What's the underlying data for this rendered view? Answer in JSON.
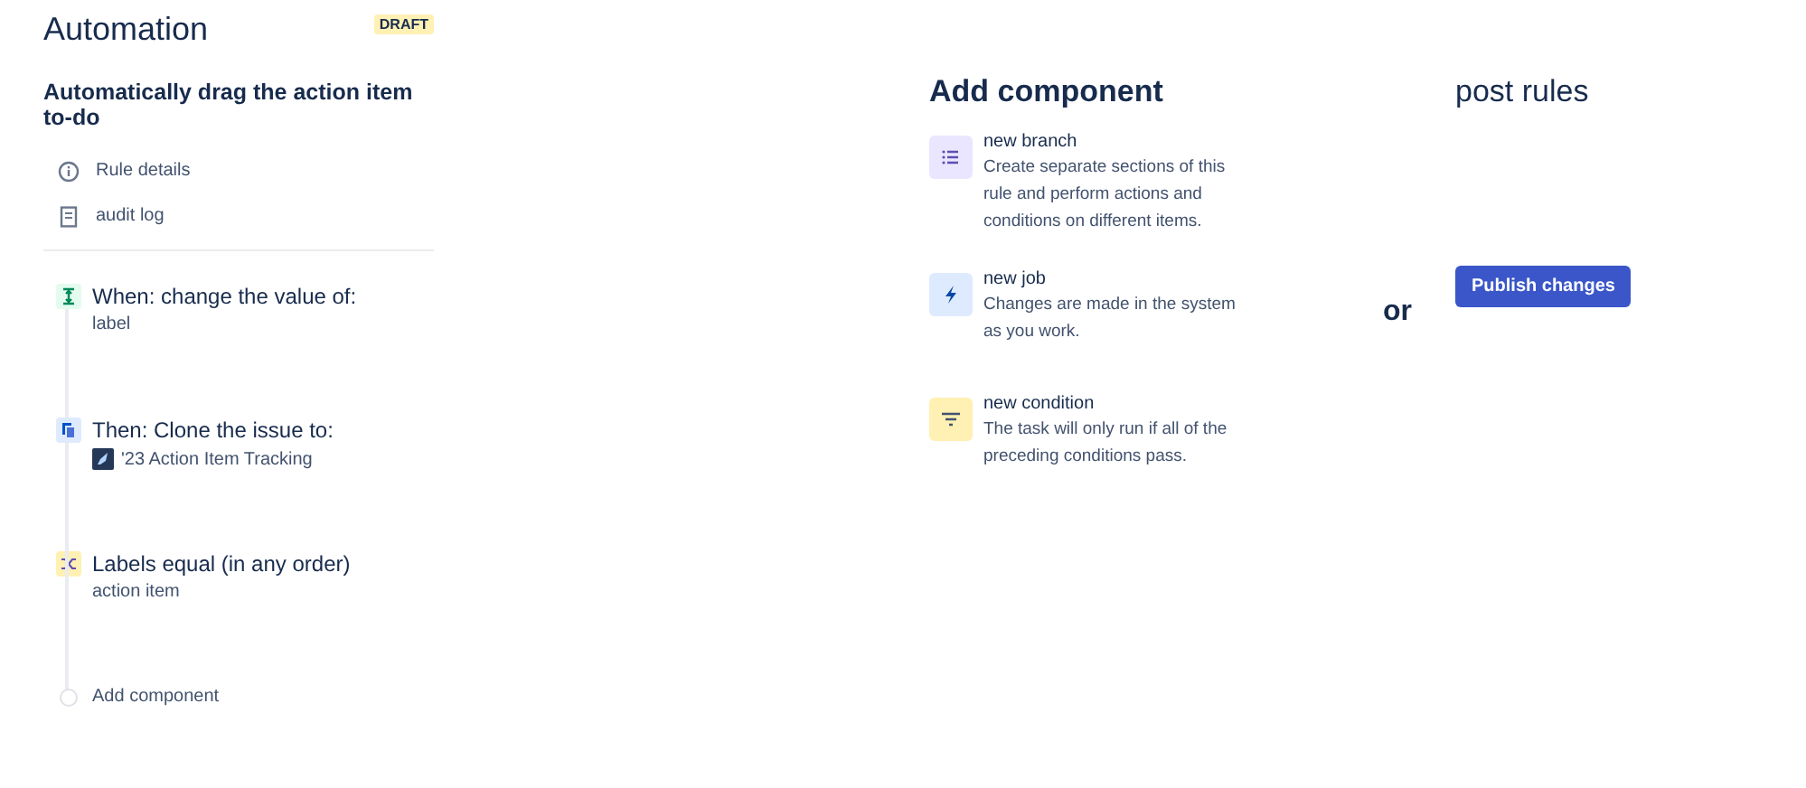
{
  "sidebar": {
    "title": "Automation",
    "badge": "DRAFT",
    "rule_name": "Automatically drag the action item to-do",
    "links": [
      {
        "kind": "info",
        "label": "Rule details"
      },
      {
        "kind": "log",
        "label": "audit log"
      }
    ]
  },
  "steps": [
    {
      "kind": "trigger",
      "title": "When: change the value of:",
      "detail": "label"
    },
    {
      "kind": "action",
      "title": "Then: Clone the issue to:",
      "detail": "'23 Action Item Tracking",
      "project_icon": true
    },
    {
      "kind": "condition",
      "title": "Labels equal (in any order)",
      "detail": "action item"
    },
    {
      "kind": "add",
      "title": "Add component"
    }
  ],
  "add_component": {
    "title": "Add component",
    "items": [
      {
        "kind": "branch",
        "name": "new branch",
        "description": "Create separate sections of this rule and perform actions and conditions on different items."
      },
      {
        "kind": "action",
        "name": "new job",
        "description": "Changes are made in the system as you work."
      },
      {
        "kind": "condition",
        "name": "new condition",
        "description": "The task will only run if all of the preceding conditions pass."
      }
    ]
  },
  "separator": "or",
  "post_rules": {
    "title": "post rules",
    "button": "Publish changes"
  }
}
